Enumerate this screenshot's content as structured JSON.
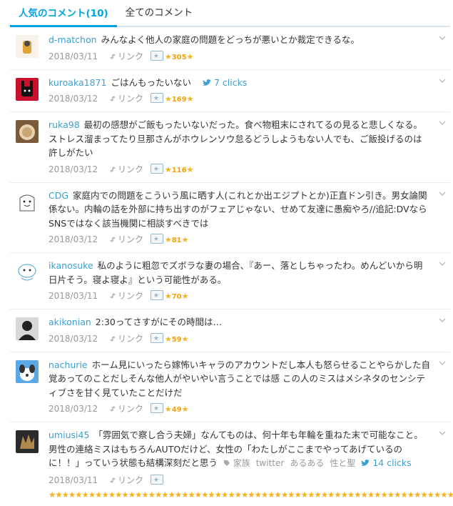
{
  "tabs": [
    {
      "label": "人気のコメント(10)",
      "active": true
    },
    {
      "label": "全てのコメント",
      "active": false
    }
  ],
  "comments": [
    {
      "user": "d-matchon",
      "text": "みんなよく他人の家庭の問題をどっちが悪いとか裁定できるな。",
      "date": "2018/03/11",
      "link": "リンク",
      "stars": "305"
    },
    {
      "user": "kuroaka1871",
      "text": "ごはんもったいない",
      "twitter": "7 clicks",
      "date": "2018/03/12",
      "link": "リンク",
      "stars": "169"
    },
    {
      "user": "ruka98",
      "text": "最初の感想がご飯もったいないだった。食べ物粗末にされてるの見ると悲しくなる。ストレス溜まってたり旦那さんがホウレンソウ怠るどうしようもない人でも、ご飯投げるのは許しがたい",
      "date": "2018/03/12",
      "link": "リンク",
      "stars": "116"
    },
    {
      "user": "CDG",
      "text": "家庭内での問題をこういう風に晒す人(これとか出エジプトとか)正直ドン引き。男女論関係ない。内輪の話を外部に持ち出すのがフェアじゃない、せめて友達に愚痴やろ//追記:DVならSNSではなく該当機関に相談すべきでは",
      "date": "2018/03/12",
      "link": "リンク",
      "stars": "81"
    },
    {
      "user": "ikanosuke",
      "text": "私のように粗忽でズボラな妻の場合、『あー、落としちゃったわ。めんどいから明日片そう。寝よ寝よ』という可能性がある。",
      "date": "2018/03/11",
      "link": "リンク",
      "stars": "70"
    },
    {
      "user": "akikonian",
      "text": "2:30ってさすがにその時間は…",
      "date": "2018/03/12",
      "link": "リンク",
      "stars": "59"
    },
    {
      "user": "nachurie",
      "text": "ホーム見にいったら嫁怖いキャラのアカウントだし本人も怒らせることやらかした自覚あってのことだしそんな他人がやいやい言うことでは感 この人のミスはメシネタのセンシティブさを甘く見ていたことだけだ",
      "date": "2018/03/12",
      "link": "リンク",
      "stars": "49"
    },
    {
      "user": "umiusi45",
      "text": "「雰囲気で察し合う夫婦」なんてものは、何十年も年輪を重ねた末で可能なこと。男性の連絡ミスはもちろんAUTOだけど、女性の「わたしがここまでやってあげているのに！！」っていう状態も結構深刻だと思う",
      "tags": [
        "家族",
        "twitter",
        "あるある",
        "性と聖"
      ],
      "twitter": "14 clicks",
      "date": "2018/03/11",
      "link": "リンク",
      "longstars": "★★★★★★★★★★★★★★★★★★★★★★★★★★★★★★★★★★★★★★★★★★★★★★★★★★★★★★★★★★★★★★★"
    }
  ],
  "colors": {
    "accent": "#00a4de",
    "user": "#3b9fd1",
    "star": "#f5b31e"
  }
}
